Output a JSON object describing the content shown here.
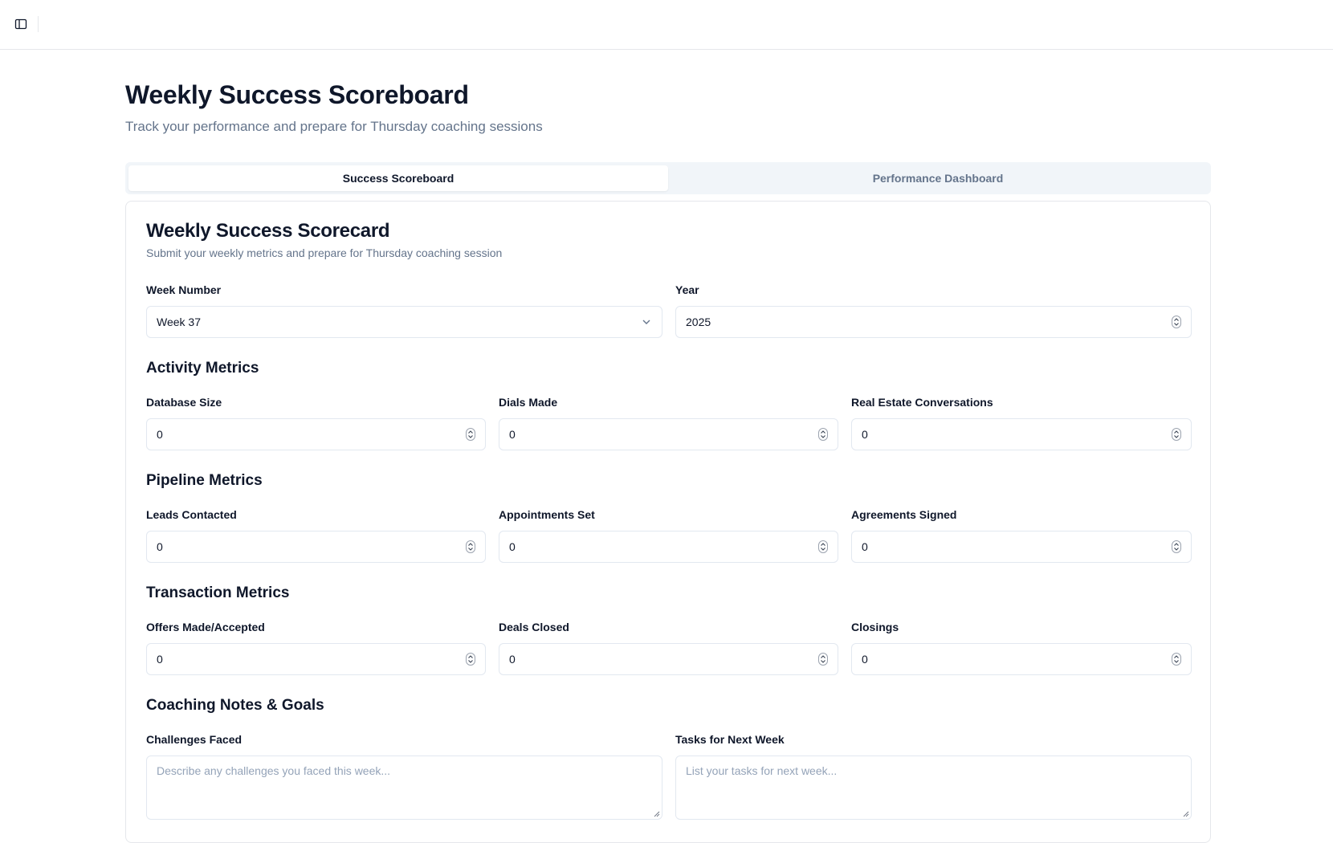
{
  "header": {
    "title": "Weekly Success Scoreboard",
    "subtitle": "Track your performance and prepare for Thursday coaching sessions"
  },
  "tabs": [
    {
      "label": "Success Scoreboard",
      "active": true
    },
    {
      "label": "Performance Dashboard",
      "active": false
    }
  ],
  "card": {
    "title": "Weekly Success Scorecard",
    "subtitle": "Submit your weekly metrics and prepare for Thursday coaching session",
    "week": {
      "label": "Week Number",
      "value": "Week 37"
    },
    "year": {
      "label": "Year",
      "value": "2025"
    },
    "activity": {
      "title": "Activity Metrics",
      "fields": [
        {
          "label": "Database Size",
          "value": "0"
        },
        {
          "label": "Dials Made",
          "value": "0"
        },
        {
          "label": "Real Estate Conversations",
          "value": "0"
        }
      ]
    },
    "pipeline": {
      "title": "Pipeline Metrics",
      "fields": [
        {
          "label": "Leads Contacted",
          "value": "0"
        },
        {
          "label": "Appointments Set",
          "value": "0"
        },
        {
          "label": "Agreements Signed",
          "value": "0"
        }
      ]
    },
    "transaction": {
      "title": "Transaction Metrics",
      "fields": [
        {
          "label": "Offers Made/Accepted",
          "value": "0"
        },
        {
          "label": "Deals Closed",
          "value": "0"
        },
        {
          "label": "Closings",
          "value": "0"
        }
      ]
    },
    "coaching": {
      "title": "Coaching Notes & Goals",
      "challenges": {
        "label": "Challenges Faced",
        "placeholder": "Describe any challenges you faced this week..."
      },
      "tasks": {
        "label": "Tasks for Next Week",
        "placeholder": "List your tasks for next week..."
      }
    }
  },
  "icons": {
    "sidebar_toggle": "sidebar-toggle-icon",
    "select_chevron": "chevron-down-icon",
    "spinner": "number-spinner-icon"
  },
  "colors": {
    "muted_text": "#64748b",
    "border": "#e2e8f0",
    "tab_bg": "#f1f5f9"
  }
}
